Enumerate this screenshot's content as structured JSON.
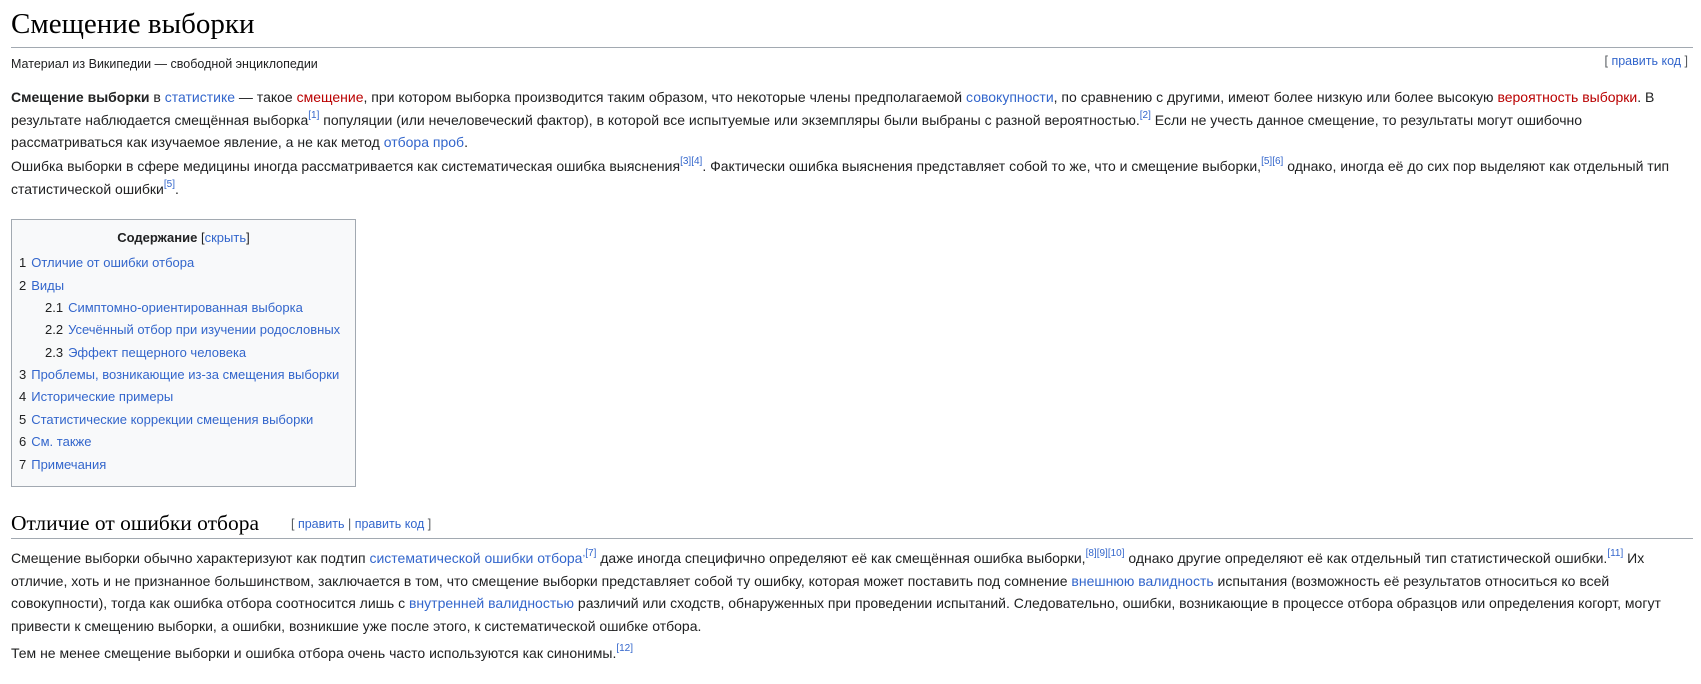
{
  "article": {
    "title": "Смещение выборки",
    "tagline": "Материал из Википедии — свободной энциклопедии",
    "edit_code": "править код"
  },
  "intro": {
    "p1": {
      "bold": "Смещение выборки",
      "t1": " в ",
      "l_statistics": "статистике",
      "t2": " — такое ",
      "l_bias": "смещение",
      "t3": ", при котором выборка производится таким образом, что некоторые члены предполагаемой ",
      "l_population": "совокупности",
      "t4": ", по сравнению с другими, имеют более низкую или более высокую ",
      "l_prob": "вероятность выборки",
      "t5": ". В результате наблюдается смещённая выборка",
      "ref1": "[1]",
      "t6": " популяции (или нечеловеческий фактор), в которой все испытуемые или экземпляры были выбраны с разной вероятностью.",
      "ref2": "[2]",
      "t7": " Если не учесть данное смещение, то результаты могут ошибочно рассматриваться как изучаемое явление, а не как метод ",
      "l_sampling": "отбора проб",
      "t8": "."
    },
    "p2": {
      "t1": "Ошибка выборки в сфере медицины иногда рассматривается как систематическая ошибка выяснения",
      "ref3": "[3]",
      "ref4": "[4]",
      "t2": ". Фактически ошибка выяснения представляет собой то же, что и смещение выборки,",
      "ref5": "[5]",
      "ref6": "[6]",
      "t3": " однако, иногда её до сих пор выделяют как отдельный тип статистической ошибки",
      "ref5b": "[5]",
      "t4": "."
    }
  },
  "toc": {
    "title": "Содержание",
    "bracket_open": "[",
    "hide": "скрыть",
    "bracket_close": "]",
    "items": [
      {
        "num": "1",
        "label": "Отличие от ошибки отбора"
      },
      {
        "num": "2",
        "label": "Виды"
      },
      {
        "num": "2.1",
        "label": "Симптомно-ориентированная выборка"
      },
      {
        "num": "2.2",
        "label": "Усечённый отбор при изучении родословных"
      },
      {
        "num": "2.3",
        "label": "Эффект пещерного человека"
      },
      {
        "num": "3",
        "label": "Проблемы, возникающие из-за смещения выборки"
      },
      {
        "num": "4",
        "label": "Исторические примеры"
      },
      {
        "num": "5",
        "label": "Статистические коррекции смещения выборки"
      },
      {
        "num": "6",
        "label": "См. также"
      },
      {
        "num": "7",
        "label": "Примечания"
      }
    ]
  },
  "section1": {
    "heading": "Отличие от ошибки отбора",
    "edit_open": "[ ",
    "edit": "править",
    "sep": " | ",
    "edit_code": "править код",
    "edit_close": " ]",
    "p1": {
      "t1": "Смещение выборки обычно характеризуют как подтип ",
      "l_syserr": "систематической ошибки отбора",
      "ref7": ",[7]",
      "t2": " даже иногда специфично определяют её как смещённая ошибка выборки,",
      "ref8": "[8]",
      "ref9": "[9]",
      "ref10": "[10]",
      "t3": " однако другие определяют её как отдельный тип статистической ошибки.",
      "ref11": "[11]",
      "t4": " Их отличие, хоть и не признанное большинством, заключается в том, что смещение выборки представляет собой ту ошибку, которая может поставить под сомнение ",
      "l_external": "внешнюю валидность",
      "t5": " испытания (возможность её результатов относиться ко всей совокупности), тогда как ошибка отбора соотносится лишь с ",
      "l_internal": "внутренней валидностью",
      "t6": " различий или сходств, обнаруженных при проведении испытаний. Следовательно, ошибки, возникающие в процессе отбора образцов или определения когорт, могут привести к смещению выборки, а ошибки, возникшие уже после этого, к систематической ошибке отбора."
    },
    "p2": {
      "t1": "Тем не менее смещение выборки и ошибка отбора очень часто используются как синонимы.",
      "ref12": "[12]"
    }
  },
  "colors": {
    "link": "#3366cc",
    "redlink": "#ba0000",
    "text": "#202122",
    "border": "#a2a9b1",
    "toc_bg": "#f8f9fa"
  }
}
